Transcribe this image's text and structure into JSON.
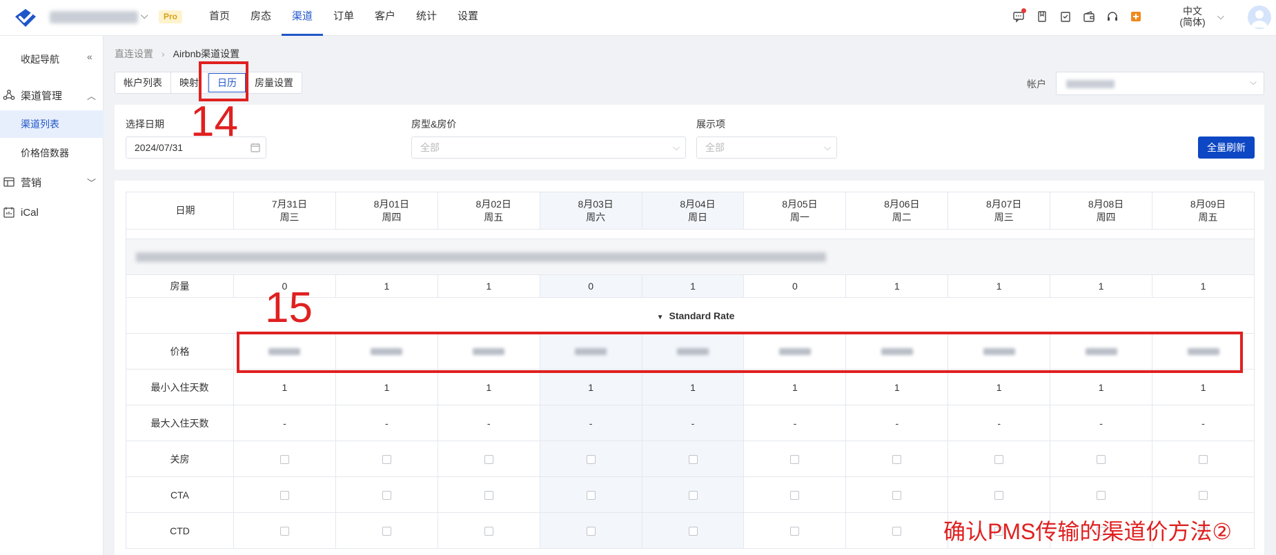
{
  "topbar": {
    "pro_badge": "Pro",
    "nav": [
      "首页",
      "房态",
      "渠道",
      "订单",
      "客户",
      "统计",
      "设置"
    ],
    "active_nav": 2,
    "language": "中文\n(简体)"
  },
  "sidebar": {
    "collapse_label": "收起导航",
    "groups": [
      {
        "label": "渠道管理",
        "icon": "channel-icon"
      },
      {
        "label": "营销",
        "icon": "marketing-icon"
      },
      {
        "label": "iCal",
        "icon": "ical-icon"
      }
    ],
    "sub_items": [
      "渠道列表",
      "价格倍数器"
    ]
  },
  "breadcrumb": {
    "parent": "直连设置",
    "current": "Airbnb渠道设置"
  },
  "tabs": [
    "帐户列表",
    "映射",
    "日历",
    "房量设置"
  ],
  "active_tab": 2,
  "account_label": "帐户",
  "filters": {
    "date_label": "选择日期",
    "date_value": "2024/07/31",
    "room_label": "房型&房价",
    "room_placeholder": "全部",
    "display_label": "展示项",
    "display_placeholder": "全部",
    "refresh_button": "全量刷新"
  },
  "grid": {
    "date_header": "日期",
    "dates": [
      {
        "date": "7月31日",
        "weekday": "周三"
      },
      {
        "date": "8月01日",
        "weekday": "周四"
      },
      {
        "date": "8月02日",
        "weekday": "周五"
      },
      {
        "date": "8月03日",
        "weekday": "周六"
      },
      {
        "date": "8月04日",
        "weekday": "周日"
      },
      {
        "date": "8月05日",
        "weekday": "周一"
      },
      {
        "date": "8月06日",
        "weekday": "周二"
      },
      {
        "date": "8月07日",
        "weekday": "周三"
      },
      {
        "date": "8月08日",
        "weekday": "周四"
      },
      {
        "date": "8月09日",
        "weekday": "周五"
      }
    ],
    "inventory_label": "房量",
    "inventory": [
      "0",
      "1",
      "1",
      "0",
      "1",
      "0",
      "1",
      "1",
      "1",
      "1"
    ],
    "rate_plan": "Standard Rate",
    "price_label": "价格",
    "min_stay_label": "最小入住天数",
    "min_stay": [
      "1",
      "1",
      "1",
      "1",
      "1",
      "1",
      "1",
      "1",
      "1",
      "1"
    ],
    "max_stay_label": "最大入住天数",
    "max_stay": [
      "-",
      "-",
      "-",
      "-",
      "-",
      "-",
      "-",
      "-",
      "-",
      "-"
    ],
    "closed_label": "关房",
    "cta_label": "CTA",
    "ctd_label": "CTD"
  },
  "annotations": {
    "step_14": "14",
    "step_15": "15",
    "caption": "确认PMS传输的渠道价方法②"
  },
  "colors": {
    "accent": "#1f56c9",
    "annotation": "#e02020",
    "button": "#0d47c4"
  }
}
